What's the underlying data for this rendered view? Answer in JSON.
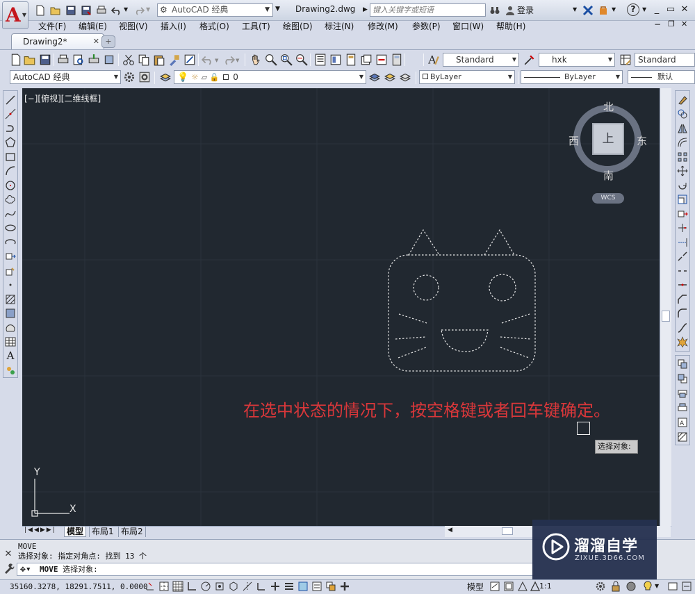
{
  "window": {
    "workspace": "AutoCAD 经典",
    "doc_title": "Drawing2.dwg",
    "search_placeholder": "键入关键字或短语",
    "login": "登录",
    "help_button": "?"
  },
  "menu": [
    "文件(F)",
    "编辑(E)",
    "视图(V)",
    "插入(I)",
    "格式(O)",
    "工具(T)",
    "绘图(D)",
    "标注(N)",
    "修改(M)",
    "参数(P)",
    "窗口(W)",
    "帮助(H)"
  ],
  "doc_tab": {
    "label": "Drawing2*"
  },
  "toolbar1": {
    "text_style": "Standard",
    "dim_style": "hxk",
    "table_style": "Standard"
  },
  "toolbar2": {
    "workspace": "AutoCAD 经典",
    "layer": "0",
    "color": "ByLayer",
    "linetype": "ByLayer",
    "lineweight": "默认"
  },
  "viewport": {
    "label": "[−][俯视][二维线框]",
    "viewcube": {
      "north": "北",
      "south": "南",
      "west": "西",
      "east": "东",
      "face": "上"
    },
    "wcs": "WCS",
    "ucs_x": "X",
    "ucs_y": "Y",
    "annotation": "在选中状态的情况下，按空格键或者回车键确定。",
    "tooltip": "选择对象:"
  },
  "layout_tabs": [
    "模型",
    "布局1",
    "布局2"
  ],
  "command": {
    "history_1": "MOVE",
    "history_2": "选择对象: 指定对角点: 找到 13 个",
    "prompt_cmd": "MOVE",
    "prompt": "选择对象:"
  },
  "status": {
    "coords": "35160.3278, 18291.7511, 0.0000",
    "model": "模型",
    "scale": "1:1"
  },
  "watermark": {
    "title": "溜溜自学",
    "url": "ZIXUE.3D66.COM"
  },
  "colors": {
    "canvas_bg": "#212830",
    "annotation": "#d9373a",
    "ui_bg": "#d6dbe9",
    "logo_red": "#c4161c"
  }
}
